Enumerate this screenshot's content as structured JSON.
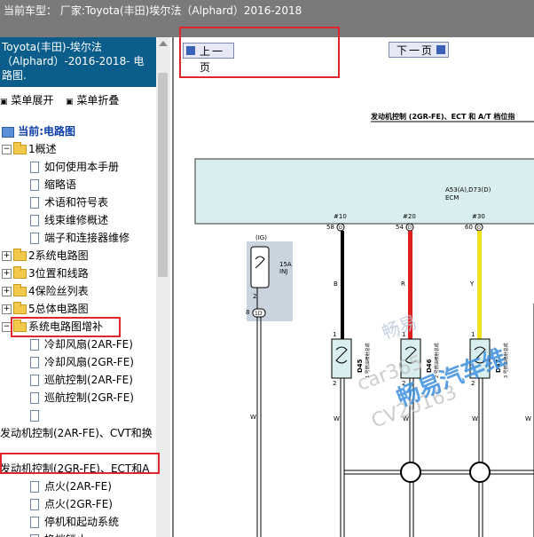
{
  "topbar": {
    "title": "当前车型：  厂家:Toyota(丰田)埃尔法（Alphard）2016-2018"
  },
  "left": {
    "book_title": "Toyota(丰田)-埃尔法（Alphard）-2016-2018- 电路图.",
    "expand_all": "菜单展开",
    "collapse_all": "菜单折叠",
    "current": "当前:电路图",
    "tree": [
      {
        "label": "1概述",
        "type": "folder",
        "level": 0,
        "expander": "−"
      },
      {
        "label": "如何使用本手册",
        "type": "page",
        "level": 1
      },
      {
        "label": "缩略语",
        "type": "page",
        "level": 1
      },
      {
        "label": "术语和符号表",
        "type": "page",
        "level": 1
      },
      {
        "label": "线束维修概述",
        "type": "page",
        "level": 1
      },
      {
        "label": "端子和连接器维修",
        "type": "page",
        "level": 1
      },
      {
        "label": "2系统电路图",
        "type": "folder",
        "level": 0,
        "expander": "+"
      },
      {
        "label": "3位置和线路",
        "type": "folder",
        "level": 0,
        "expander": "+"
      },
      {
        "label": "4保险丝列表",
        "type": "folder",
        "level": 0,
        "expander": "+"
      },
      {
        "label": "5总体电路图",
        "type": "folder",
        "level": 0,
        "expander": "+"
      },
      {
        "label": "系统电路图增补",
        "type": "folder",
        "level": 0,
        "expander": "−"
      },
      {
        "label": "冷却风扇(2AR-FE)",
        "type": "page",
        "level": 1
      },
      {
        "label": "冷却风扇(2GR-FE)",
        "type": "page",
        "level": 1
      },
      {
        "label": "巡航控制(2AR-FE)",
        "type": "page",
        "level": 1
      },
      {
        "label": "巡航控制(2GR-FE)",
        "type": "page",
        "level": 1
      },
      {
        "label": "",
        "type": "page",
        "level": 1
      },
      {
        "label": "发动机控制(2AR-FE)、CVT和换",
        "type": "text",
        "level": -1
      },
      {
        "label": "",
        "type": "blank",
        "level": 1
      },
      {
        "label": "发动机控制(2GR-FE)、ECT和A",
        "type": "text",
        "level": -1
      },
      {
        "label": "点火(2AR-FE)",
        "type": "page",
        "level": 1
      },
      {
        "label": "点火(2GR-FE)",
        "type": "page",
        "level": 1
      },
      {
        "label": "停机和起动系统",
        "type": "page",
        "level": 1
      },
      {
        "label": "换档锁止",
        "type": "page",
        "level": 1
      }
    ]
  },
  "nav": {
    "prev": "上一页",
    "next": "下一页"
  },
  "diagram": {
    "title": "发动机控制 (2GR-FE)、ECT 和 A/T 档位指",
    "ecm_label1": "A53(A),D73(D)",
    "ecm_label2": "ECM",
    "pins": [
      "#10",
      "#20",
      "#30"
    ],
    "pin_nums": [
      "58",
      "54",
      "60"
    ],
    "pin_letter": "D",
    "ig": "(IG)",
    "fuse_label1": "15A",
    "fuse_label2": "INJ",
    "wire_colors": [
      "B",
      "R",
      "Y"
    ],
    "conn_ids": [
      "D45",
      "D46",
      "D47"
    ],
    "conn_texts": [
      "1 号燃油喷射总成",
      "2 号燃油喷射总成",
      "3 号燃油喷射总成"
    ],
    "pin_small_2": "2",
    "pin_small_8": "8",
    "pin_small_1": "1",
    "1d": "1D",
    "w_labels": [
      "W",
      "W",
      "W",
      "W",
      "W"
    ],
    "watermark1": "畅易",
    "watermark2": "car365",
    "watermark3": "CV20163",
    "watermark4": "畅易汽车维",
    "colors": {
      "black_wire": "#000000",
      "red_wire": "#e01f1f",
      "yellow_wire": "#f2e21d",
      "ecm_fill": "#d9eeee",
      "ig_fill": "#c9d4df"
    }
  }
}
